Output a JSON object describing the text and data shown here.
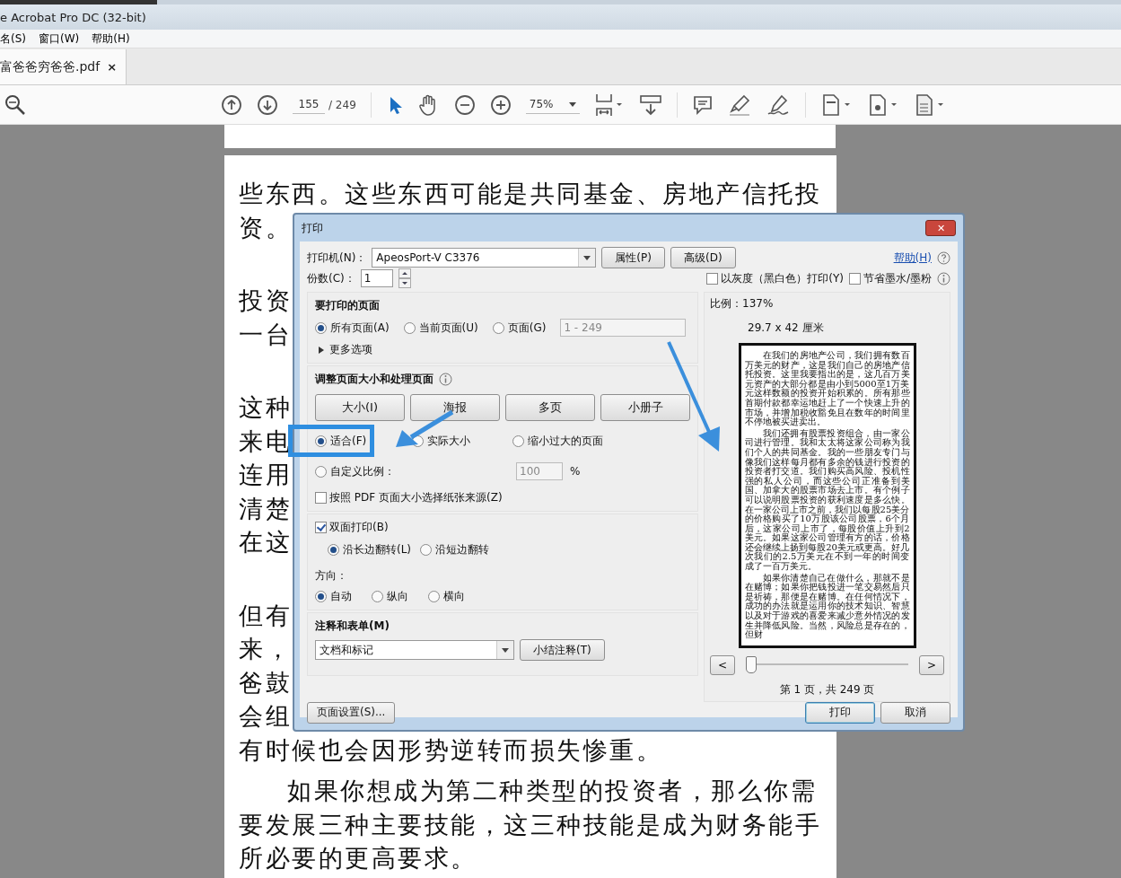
{
  "window": {
    "title": "e Acrobat Pro DC (32-bit)"
  },
  "menu": [
    "名(S)",
    "窗口(W)",
    "帮助(H)"
  ],
  "tabs": [
    {
      "label": "富爸爸穷爸爸.pdf",
      "close": "×",
      "selected": true
    }
  ],
  "toolbar": {
    "page": "155",
    "page_total": "/ 249",
    "zoom": "75%"
  },
  "document": {
    "paragraphs": [
      {
        "kind": "fragments",
        "lines": [
          "些东西。这些东西可能是共同基金、房地产信托投",
          "资。"
        ]
      },
      {
        "kind": "fragments",
        "lines": [
          "投资",
          "一台"
        ]
      },
      {
        "kind": "fragments",
        "lines": [
          "这种",
          "来电",
          "连用",
          "清楚",
          "在这"
        ]
      },
      {
        "kind": "fragments",
        "lines": [
          "但有",
          "来，",
          "爸鼓",
          "会组",
          "有时候也会因形势逆转而损失惨重。"
        ]
      },
      {
        "kind": "prose",
        "lines": [
          "如果你想成为第二种类型的投资者，那么你需要发展三种主要技能，这三种技能是成为财务能手所必要的更高要求。"
        ]
      }
    ]
  },
  "dialog": {
    "title": "打印",
    "close": "✕",
    "printer": {
      "label": "打印机(N)：",
      "value": "ApeosPort-V C3376",
      "buttons": [
        "属性(P)",
        "高级(D)"
      ],
      "help": "帮助(H)"
    },
    "copies": {
      "label": "份数(C)：",
      "value": "1"
    },
    "options": [
      {
        "label": "以灰度（黑白色）打印(Y)",
        "checked": false
      },
      {
        "label": "节省墨水/墨粉",
        "checked": false
      }
    ],
    "pages": {
      "heading": "要打印的页面",
      "radios": [
        {
          "label": "所有页面(A)",
          "selected": true
        },
        {
          "label": "当前页面(U)",
          "selected": false
        },
        {
          "label": "页面(G)",
          "selected": false
        }
      ],
      "range": "1 - 249",
      "more": "更多选项"
    },
    "sizing": {
      "heading": "调整页面大小和处理页面",
      "buttons": [
        "大小(I)",
        "海报",
        "多页",
        "小册子"
      ],
      "radios": [
        {
          "label": "适合(F)",
          "selected": true
        },
        {
          "label": "实际大小",
          "selected": false
        },
        {
          "label": "缩小过大的页面",
          "selected": false
        },
        {
          "label": "自定义比例：",
          "selected": false
        }
      ],
      "scale": "100",
      "percent": "%",
      "paper_source": {
        "label": "按照 PDF 页面大小选择纸张来源(Z)",
        "checked": false
      }
    },
    "duplex": {
      "label": "双面打印(B)",
      "checked": true,
      "radios": [
        {
          "label": "沿长边翻转(L)",
          "selected": true
        },
        {
          "label": "沿短边翻转",
          "selected": false
        }
      ]
    },
    "orientation": {
      "label": "方向：",
      "radios": [
        {
          "label": "自动",
          "selected": true
        },
        {
          "label": "纵向",
          "selected": false
        },
        {
          "label": "横向",
          "selected": false
        }
      ]
    },
    "comments": {
      "heading": "注释和表单(M)",
      "value": "文档和标记",
      "button": "小结注释(T)"
    },
    "preview": {
      "scale": "比例：137%",
      "size": "29.7 x 42 厘米",
      "paragraphs": [
        "在我们的房地产公司，我们拥有数百万美元的财产，这是我们自己的房地产信托投资。这里我要指出的是，这几百万美元资产的大部分都是由小到5000至1万美元这样数额的投资开始积累的。所有那些首期付款都幸运地赶上了一个快速上升的市场，并增加税收豁免且在数年的时间里不停地被买进卖出。",
        "我们还拥有股票投资组合，由一家公司进行管理。我和太太将这家公司称为我们个人的共同基金。我的一些朋友专门与像我们这样每月都有多余的钱进行投资的投资者打交道。我们购买高风险、投机性强的私人公司，而这些公司正准备到美国、加拿大的股票市场去上市。有个例子可以说明股票投资的获利速度是多么快。在一家公司上市之前，我们以每股25美分的价格购买了10万股该公司股票，6个月后，这家公司上市了，每股价值上升到2美元。如果这家公司管理有方的话，价格还会继续上扬到每股20美元或更高。好几次我们的2.5万美元在不到一年的时间变成了一百万美元。",
        "如果你清楚自己在做什么，那就不是在赌博；如果你把钱投进一笔交易然后只是祈祷，那便是在赌博。在任何情况下，成功的办法就是运用你的技术知识、智慧以及对于游戏的喜爱来减少意外情况的发生并降低风险。当然，风险总是存在的，但财"
      ],
      "prev": "<",
      "next": ">",
      "slider": {
        "level": 0
      },
      "page_label": "第 1 页，共 249 页"
    },
    "footer": {
      "setup": "页面设置(S)...",
      "print": "打印",
      "cancel": "取消"
    }
  }
}
